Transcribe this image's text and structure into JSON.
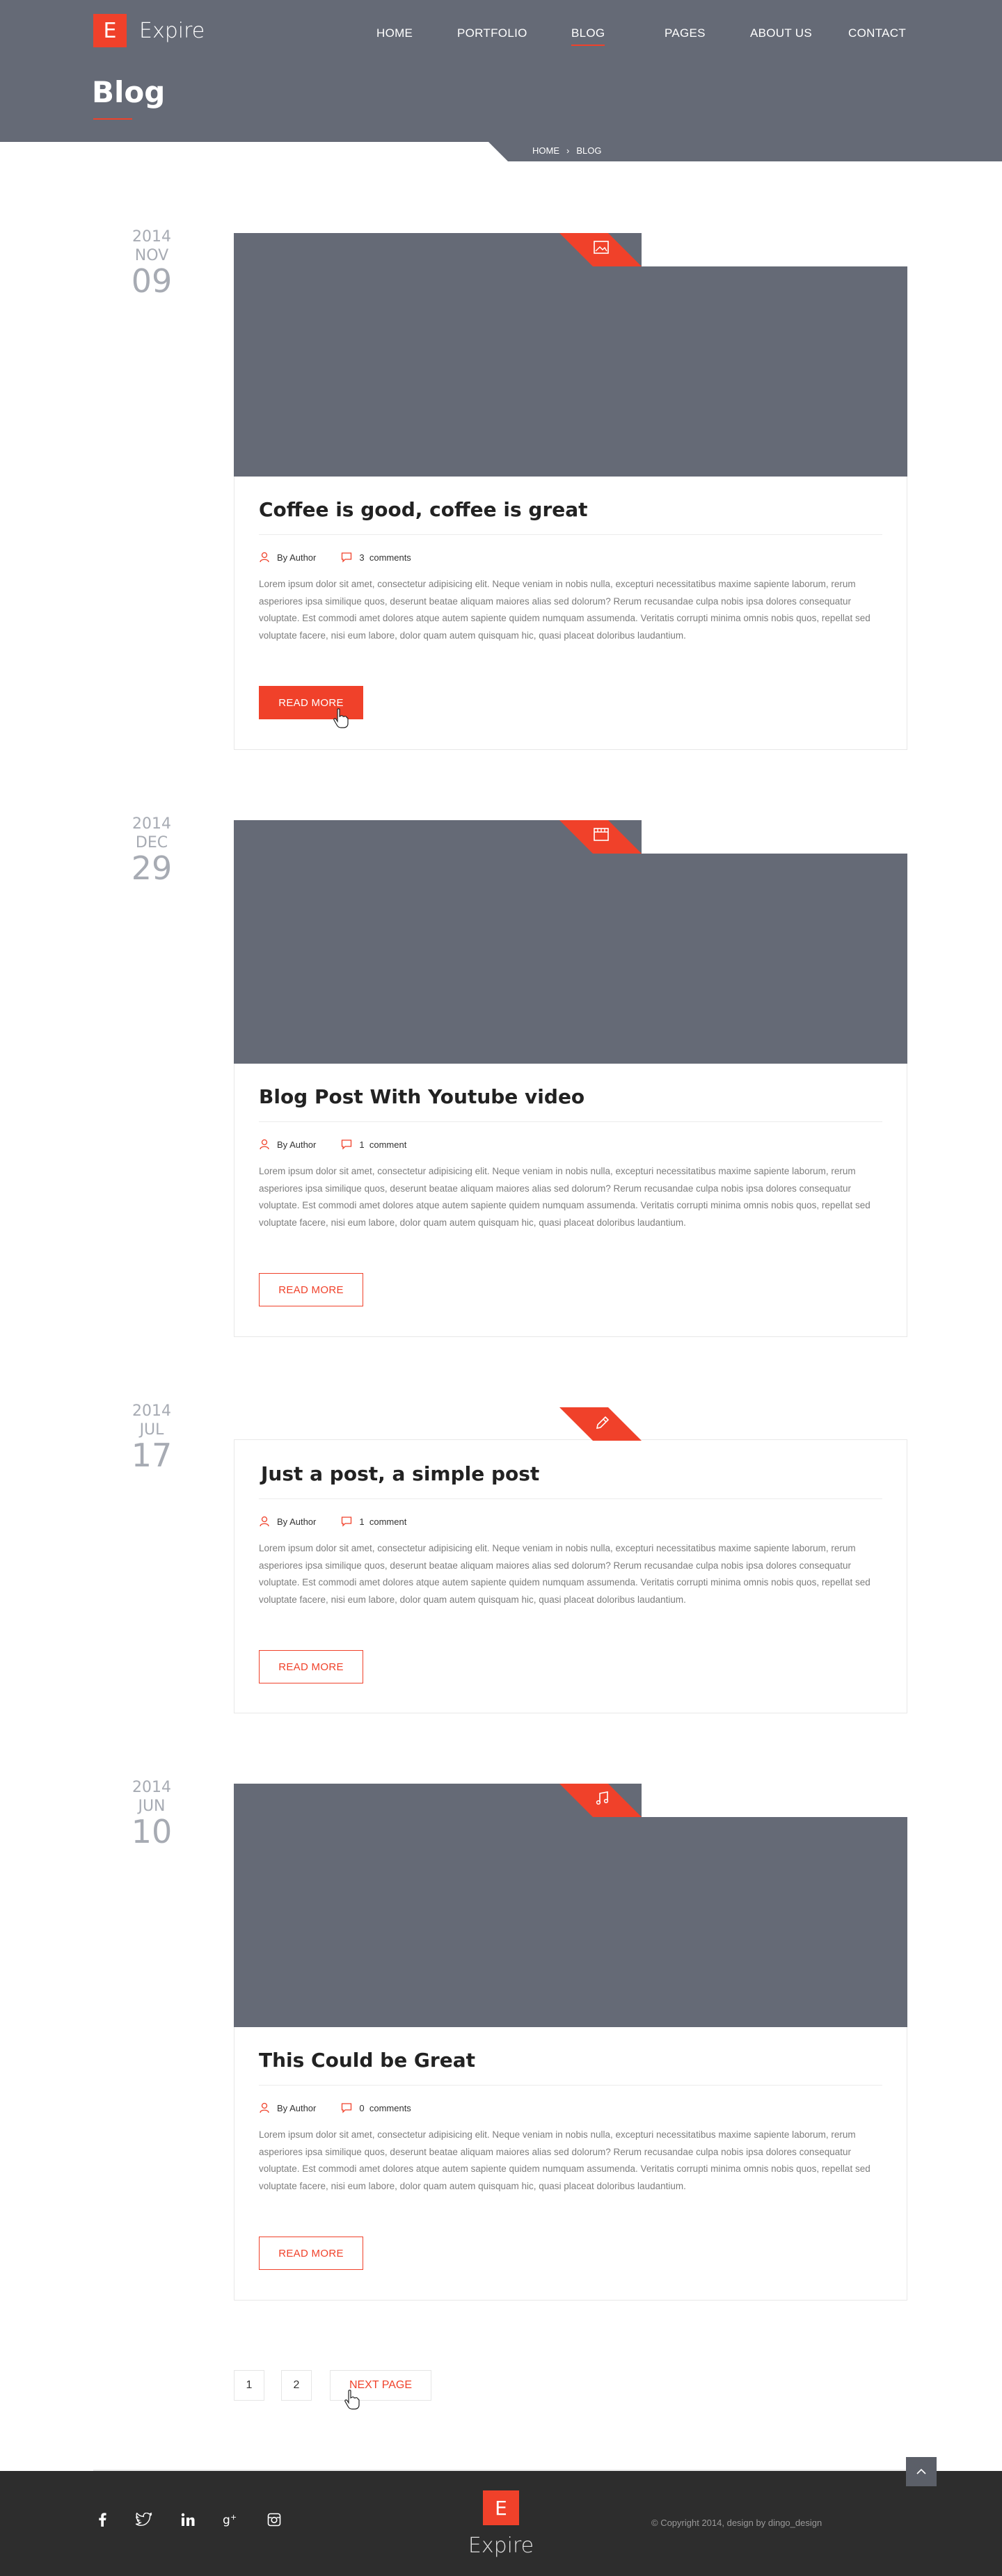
{
  "site": {
    "logo_letter": "E",
    "logo_text": "Expire"
  },
  "nav": {
    "items": [
      {
        "label": "HOME",
        "active": false
      },
      {
        "label": "PORTFOLIO",
        "active": false
      },
      {
        "label": "BLOG",
        "active": true
      },
      {
        "label": "PAGES",
        "active": false
      },
      {
        "label": "ABOUT US",
        "active": false
      },
      {
        "label": "CONTACT",
        "active": false
      }
    ]
  },
  "page": {
    "title": "Blog"
  },
  "breadcrumb": {
    "home": "HOME",
    "separator": "›",
    "current": "BLOG"
  },
  "colors": {
    "accent": "#f0412a",
    "header_bg": "#656a76",
    "footer_bg": "#2d2d2d"
  },
  "posts": [
    {
      "year": "2014",
      "month": "NOV",
      "day": "09",
      "format_icon": "image-icon",
      "title": "Coffee is good, coffee is great",
      "author": "By Author",
      "comment_count": "3",
      "comment_label": "comments",
      "excerpt": "Lorem ipsum dolor sit amet, consectetur adipisicing elit. Neque veniam in nobis nulla, excepturi necessitatibus maxime sapiente laborum, rerum asperiores ipsa similique quos, deserunt beatae aliquam maiores alias sed dolorum? Rerum recusandae culpa nobis ipsa dolores consequatur voluptate. Est commodi amet dolores atque autem sapiente quidem numquam assumenda. Veritatis corrupti minima omnis nobis quos, repellat sed voluptate facere, nisi eum labore, dolor quam autem quisquam hic, quasi placeat doloribus laudantium.",
      "button": "READ MORE"
    },
    {
      "year": "2014",
      "month": "DEC",
      "day": "29",
      "format_icon": "video-icon",
      "title": "Blog Post With Youtube video",
      "author": "By Author",
      "comment_count": "1",
      "comment_label": "comment",
      "excerpt": "Lorem ipsum dolor sit amet, consectetur adipisicing elit. Neque veniam in nobis nulla, excepturi necessitatibus maxime sapiente laborum, rerum asperiores ipsa similique quos, deserunt beatae aliquam maiores alias sed dolorum? Rerum recusandae culpa nobis ipsa dolores consequatur voluptate. Est commodi amet dolores atque autem sapiente quidem numquam assumenda. Veritatis corrupti minima omnis nobis quos, repellat sed voluptate facere, nisi eum labore, dolor quam autem quisquam hic, quasi placeat doloribus laudantium.",
      "button": "READ MORE"
    },
    {
      "year": "2014",
      "month": "JUL",
      "day": "17",
      "format_icon": "pencil-icon",
      "title": "Just a post, a simple post",
      "author": "By Author",
      "comment_count": "1",
      "comment_label": "comment",
      "excerpt": "Lorem ipsum dolor sit amet, consectetur adipisicing elit. Neque veniam in nobis nulla, excepturi necessitatibus maxime sapiente laborum, rerum asperiores ipsa similique quos, deserunt beatae aliquam maiores alias sed dolorum? Rerum recusandae culpa nobis ipsa dolores consequatur voluptate. Est commodi amet dolores atque autem sapiente quidem numquam assumenda. Veritatis corrupti minima omnis nobis quos, repellat sed voluptate facere, nisi eum labore, dolor quam autem quisquam hic, quasi placeat doloribus laudantium.",
      "button": "READ MORE"
    },
    {
      "year": "2014",
      "month": "JUN",
      "day": "10",
      "format_icon": "music-icon",
      "title": "This Could be Great",
      "author": "By Author",
      "comment_count": "0",
      "comment_label": "comments",
      "excerpt": "Lorem ipsum dolor sit amet, consectetur adipisicing elit. Neque veniam in nobis nulla, excepturi necessitatibus maxime sapiente laborum, rerum asperiores ipsa similique quos, deserunt beatae aliquam maiores alias sed dolorum? Rerum recusandae culpa nobis ipsa dolores consequatur voluptate. Est commodi amet dolores atque autem sapiente quidem numquam assumenda. Veritatis corrupti minima omnis nobis quos, repellat sed voluptate facere, nisi eum labore, dolor quam autem quisquam hic, quasi placeat doloribus laudantium.",
      "button": "READ MORE"
    }
  ],
  "pagination": {
    "page1": "1",
    "page2": "2",
    "next": "NEXT PAGE"
  },
  "footer": {
    "logo_letter": "E",
    "logo_text": "Expire",
    "copyright": "© Copyright 2014, design by dingo_design",
    "social_icons": [
      "facebook-icon",
      "twitter-icon",
      "linkedin-icon",
      "google-plus-icon",
      "instagram-icon"
    ]
  }
}
